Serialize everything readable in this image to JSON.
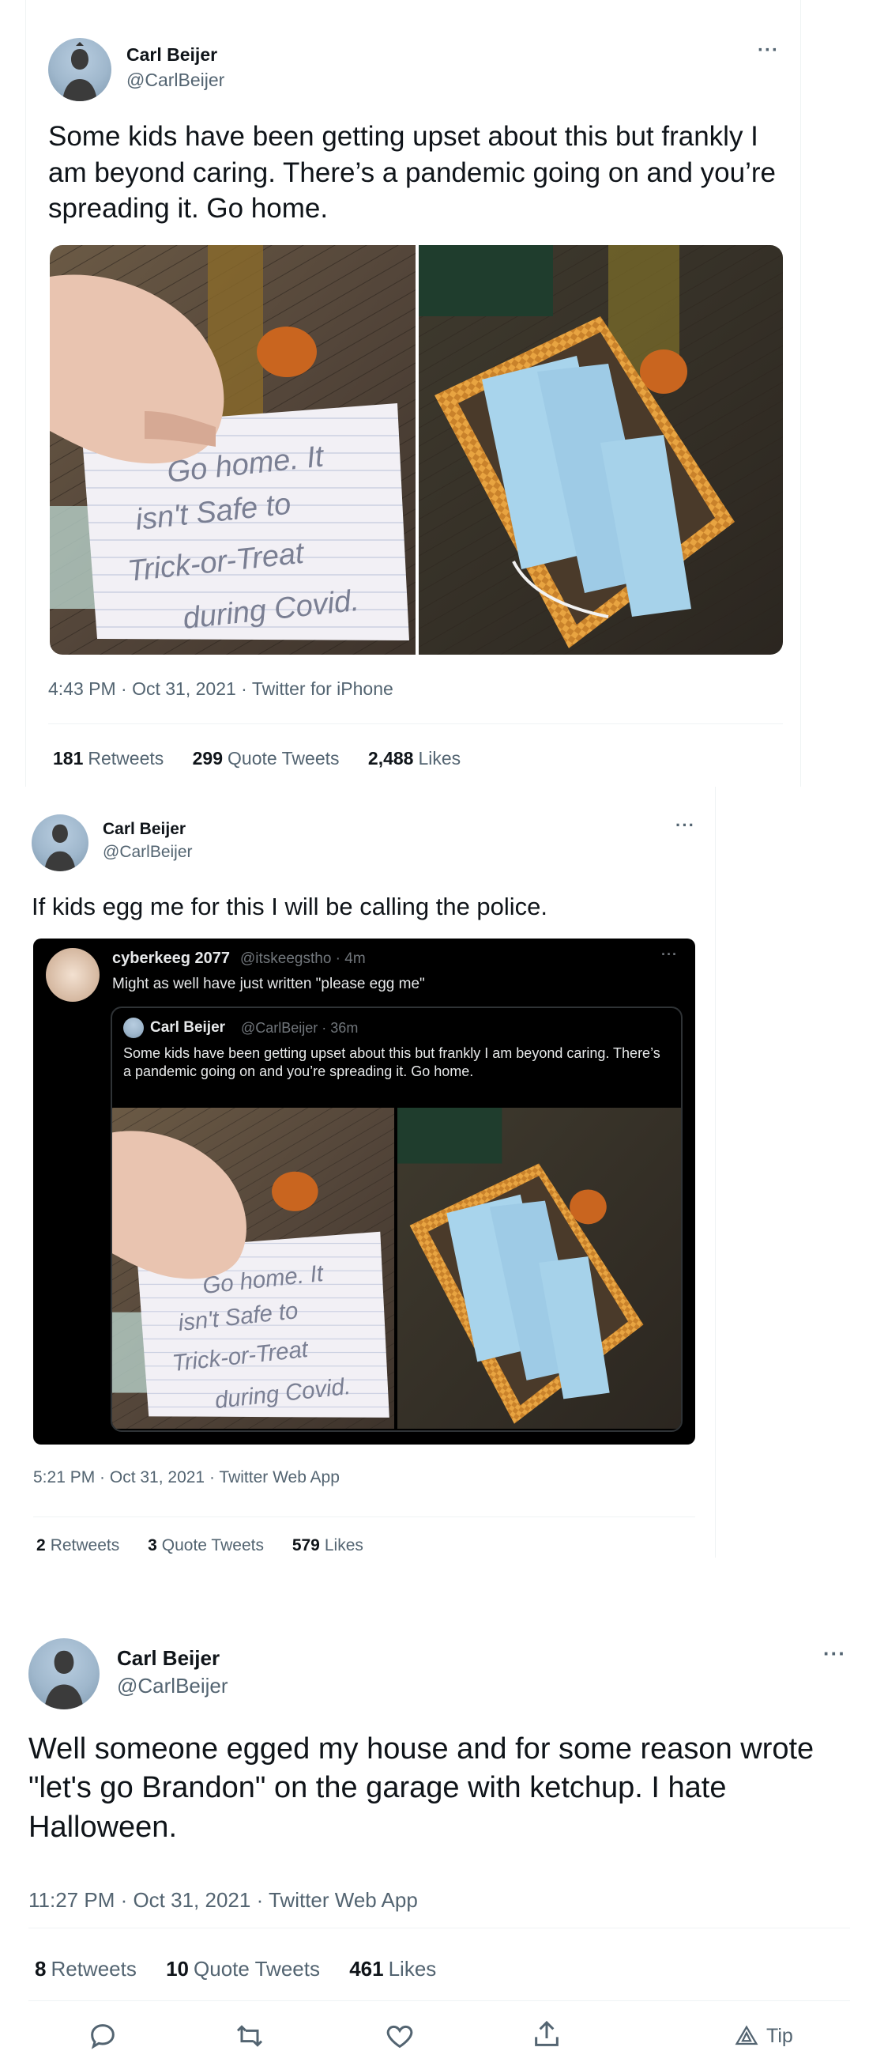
{
  "tweet1": {
    "author_name": "Carl Beijer",
    "author_handle": "@CarlBeijer",
    "text": "Some kids have been getting upset about this but frankly I am beyond caring. There’s a pandemic going on and you’re spreading it. Go home.",
    "note_text": [
      "Go home. It",
      "isn't Safe to",
      "Trick-or-Treat",
      "during Covid."
    ],
    "timestamp": "4:43 PM · Oct 31, 2021 · Twitter for iPhone",
    "stats": [
      {
        "count": "181",
        "label": "Retweets"
      },
      {
        "count": "299",
        "label": "Quote Tweets"
      },
      {
        "count": "2,488",
        "label": "Likes"
      }
    ]
  },
  "tweet2": {
    "author_name": "Carl Beijer",
    "author_handle": "@CarlBeijer",
    "text": "If kids egg me for this I will be calling the police.",
    "quote": {
      "name": "cyberkeeg 2077",
      "meta": "@itskeegstho · 4m",
      "text": "Might as well have just written \"please egg me\"",
      "inner": {
        "name": "Carl Beijer",
        "meta": "@CarlBeijer · 36m",
        "text": "Some kids have been getting upset about this but frankly I am beyond caring. There’s a pandemic going on and you’re spreading it. Go home."
      }
    },
    "timestamp": "5:21 PM · Oct 31, 2021 · Twitter Web App",
    "stats": [
      {
        "count": "2",
        "label": "Retweets"
      },
      {
        "count": "3",
        "label": "Quote Tweets"
      },
      {
        "count": "579",
        "label": "Likes"
      }
    ]
  },
  "tweet3": {
    "author_name": "Carl Beijer",
    "author_handle": "@CarlBeijer",
    "text": "Well someone egged my house and for some reason wrote \"let's go Brandon\" on the garage with ketchup. I hate Halloween.",
    "timestamp": "11:27 PM · Oct 31, 2021 · Twitter Web App",
    "stats": [
      {
        "count": "8",
        "label": "Retweets"
      },
      {
        "count": "10",
        "label": "Quote Tweets"
      },
      {
        "count": "461",
        "label": "Likes"
      }
    ],
    "actions": {
      "tip_label": "Tip"
    }
  },
  "more_label": "···",
  "colors": {
    "text": "#0f1419",
    "secondary": "#536471",
    "divider": "#eff3f4",
    "mask_blue": "#a8d4ec",
    "basket": "#d9902f"
  },
  "icons": [
    "reply-icon",
    "retweet-icon",
    "like-icon",
    "share-icon",
    "tip-icon",
    "more-icon"
  ]
}
